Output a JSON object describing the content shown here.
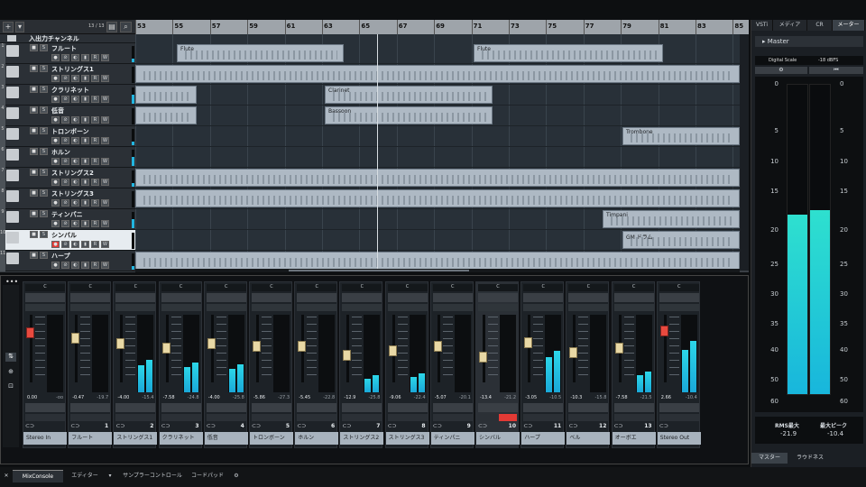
{
  "project": {
    "toolbar": {
      "add_label": "+",
      "dropdown_label": "▾",
      "track_count": "13 / 13"
    },
    "ruler_bars": [
      "53",
      "55",
      "57",
      "59",
      "61",
      "63",
      "65",
      "67",
      "69",
      "71",
      "73",
      "75",
      "77",
      "79",
      "81",
      "83",
      "85"
    ],
    "tracks": [
      {
        "num": "",
        "name": "入出力チャンネル",
        "type": "folder"
      },
      {
        "num": "1",
        "name": "フルート"
      },
      {
        "num": "2",
        "name": "ストリングス1"
      },
      {
        "num": "3",
        "name": "クラリネット"
      },
      {
        "num": "4",
        "name": "低音"
      },
      {
        "num": "5",
        "name": "トロンボーン"
      },
      {
        "num": "6",
        "name": "ホルン"
      },
      {
        "num": "7",
        "name": "ストリングス2"
      },
      {
        "num": "8",
        "name": "ストリングス3"
      },
      {
        "num": "9",
        "name": "ティンパニ"
      },
      {
        "num": "10",
        "name": "シンバル",
        "selected": true
      },
      {
        "num": "11",
        "name": "ハープ"
      }
    ],
    "parts": [
      {
        "label": "Flute",
        "lane": 1
      },
      {
        "label": "Flute",
        "lane": 1
      },
      {
        "label": "",
        "lane": 2
      },
      {
        "label": "",
        "lane": 3
      },
      {
        "label": "Clarinet",
        "lane": 3
      },
      {
        "label": "",
        "lane": 4
      },
      {
        "label": "Bassoon",
        "lane": 4
      },
      {
        "label": "Trombone",
        "lane": 5
      },
      {
        "label": "",
        "lane": 7
      },
      {
        "label": "",
        "lane": 8
      },
      {
        "label": "Timpani",
        "lane": 9
      },
      {
        "label": "GM ドラム",
        "lane": 10
      },
      {
        "label": "",
        "lane": 11
      }
    ]
  },
  "right_zone": {
    "tabs": [
      "VSTi",
      "メディア",
      "CR",
      "メーター"
    ],
    "active_tab": "メーター",
    "master_label": "Master",
    "digital_scale_label": "Digital Scale",
    "digital_scale_value": "-18 dBFS",
    "scale_marks": [
      "0",
      "5",
      "10",
      "15",
      "20",
      "25",
      "30",
      "35",
      "40",
      "50",
      "60"
    ],
    "meter_levels": {
      "left": 0.77,
      "right": 0.79
    },
    "rms_label": "RMS最大",
    "rms_value": "-21.9",
    "peak_label": "最大ピーク",
    "peak_value": "-10.4",
    "bottom_tabs": [
      "マスター",
      "ラウドネス"
    ]
  },
  "mixer": {
    "channels": [
      {
        "name": "Stereo In",
        "num": "",
        "v1": "0.00",
        "v2": "-oo",
        "meter": 0.0,
        "fader": 0.22,
        "red": true
      },
      {
        "name": "フルート",
        "num": "1",
        "v1": "-0.47",
        "v2": "-19.7",
        "meter": 0.0,
        "fader": 0.3
      },
      {
        "name": "ストリングス1",
        "num": "2",
        "v1": "-4.00",
        "v2": "-15.4",
        "meter": 0.35,
        "fader": 0.4
      },
      {
        "name": "クラリネット",
        "num": "3",
        "v1": "-7.58",
        "v2": "-24.8",
        "meter": 0.32,
        "fader": 0.48
      },
      {
        "name": "低音",
        "num": "4",
        "v1": "-4.00",
        "v2": "-25.8",
        "meter": 0.3,
        "fader": 0.4
      },
      {
        "name": "トロンボーン",
        "num": "5",
        "v1": "-5.86",
        "v2": "-27.3",
        "meter": 0.0,
        "fader": 0.45
      },
      {
        "name": "ホルン",
        "num": "6",
        "v1": "-5.45",
        "v2": "-22.8",
        "meter": 0.0,
        "fader": 0.44
      },
      {
        "name": "ストリングス2",
        "num": "7",
        "v1": "-12.9",
        "v2": "-25.8",
        "meter": 0.18,
        "fader": 0.6
      },
      {
        "name": "ストリングス3",
        "num": "8",
        "v1": "-9.06",
        "v2": "-22.4",
        "meter": 0.2,
        "fader": 0.52
      },
      {
        "name": "ティンパニ",
        "num": "9",
        "v1": "-5.07",
        "v2": "-20.1",
        "meter": 0.0,
        "fader": 0.44
      },
      {
        "name": "シンバル",
        "num": "10",
        "v1": "-13.4",
        "v2": "-21.2",
        "meter": 0.0,
        "fader": 0.63,
        "selected": true
      },
      {
        "name": "ハープ",
        "num": "11",
        "v1": "-3.05",
        "v2": "-10.5",
        "meter": 0.45,
        "fader": 0.38
      },
      {
        "name": "ベル",
        "num": "12",
        "v1": "-10.3",
        "v2": "-15.8",
        "meter": 0.0,
        "fader": 0.55
      },
      {
        "name": "オーボエ",
        "num": "13",
        "v1": "-7.58",
        "v2": "-21.5",
        "meter": 0.22,
        "fader": 0.48
      },
      {
        "name": "Stereo Out",
        "num": "",
        "v1": "2.66",
        "v2": "-10.4",
        "meter": 0.55,
        "fader": 0.18,
        "red": true
      }
    ]
  },
  "bottom_tabs": [
    "MixConsole",
    "エディター",
    "サンプラーコントロール",
    "コードパッド"
  ]
}
